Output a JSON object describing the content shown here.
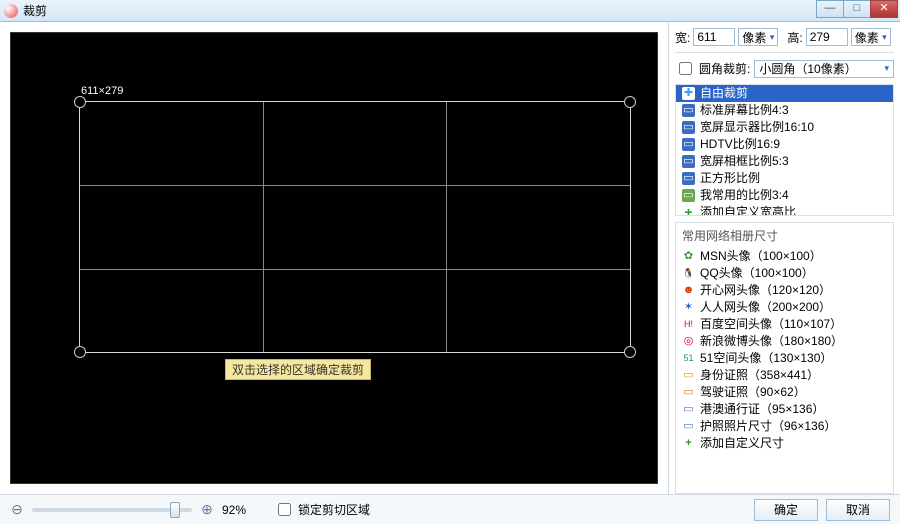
{
  "window": {
    "title": "裁剪"
  },
  "canvas": {
    "dimension_label": "611×279",
    "hint": "双击选择的区域确定裁剪"
  },
  "dims": {
    "width_label": "宽:",
    "width_value": "611",
    "width_unit": "像素",
    "height_label": "高:",
    "height_value": "279",
    "height_unit": "像素"
  },
  "round": {
    "checkbox_label": "圆角裁剪:",
    "select_label": "小圆角（10像素）"
  },
  "ratios": [
    {
      "icon": "✚",
      "icon_bg": "#fff",
      "icon_color": "#4aa0e8",
      "label": "自由裁剪",
      "selected": true
    },
    {
      "icon": "▭",
      "icon_bg": "#3a6cc0",
      "icon_color": "#fff",
      "label": "标准屏幕比例4:3"
    },
    {
      "icon": "▭",
      "icon_bg": "#3a6cc0",
      "icon_color": "#fff",
      "label": "宽屏显示器比例16:10"
    },
    {
      "icon": "▭",
      "icon_bg": "#3a6cc0",
      "icon_color": "#fff",
      "label": "HDTV比例16:9"
    },
    {
      "icon": "▭",
      "icon_bg": "#3a6cc0",
      "icon_color": "#fff",
      "label": "宽屏相框比例5:3"
    },
    {
      "icon": "▭",
      "icon_bg": "#3a6cc0",
      "icon_color": "#fff",
      "label": "正方形比例"
    },
    {
      "icon": "▭",
      "icon_bg": "#6aa84f",
      "icon_color": "#fff",
      "label": "我常用的比例3:4"
    },
    {
      "icon": "+",
      "icon_bg": "transparent",
      "icon_color": "#2a9a2a",
      "label": "添加自定义宽高比"
    }
  ],
  "presets_header": "常用网络相册尺寸",
  "presets": [
    {
      "icon": "✿",
      "icon_color": "#3a9a3a",
      "label": "MSN头像（100×100）"
    },
    {
      "icon": "🐧",
      "icon_color": "#d88b00",
      "label": "QQ头像（100×100）"
    },
    {
      "icon": "☻",
      "icon_color": "#d83a00",
      "label": "开心网头像（120×120）"
    },
    {
      "icon": "✶",
      "icon_color": "#1a5fc8",
      "label": "人人网头像（200×200）"
    },
    {
      "icon": "H!",
      "icon_color": "#d8002a",
      "label": "百度空间头像（110×107）"
    },
    {
      "icon": "◎",
      "icon_color": "#d8002a",
      "label": "新浪微博头像（180×180）"
    },
    {
      "icon": "51",
      "icon_color": "#1a9a6a",
      "label": "51空间头像（130×130）"
    },
    {
      "icon": "▭",
      "icon_color": "#d8a000",
      "label": "身份证照（358×441）"
    },
    {
      "icon": "▭",
      "icon_color": "#d87a00",
      "label": "驾驶证照（90×62）"
    },
    {
      "icon": "▭",
      "icon_color": "#4a7ac8",
      "label": "港澳通行证（95×136）"
    },
    {
      "icon": "▭",
      "icon_color": "#4a7ac8",
      "label": "护照照片尺寸（96×136）"
    },
    {
      "icon": "+",
      "icon_color": "#2a9a2a",
      "label": "添加自定义尺寸"
    }
  ],
  "footer": {
    "zoom_percent": "92%",
    "lock_label": "锁定剪切区域",
    "ok": "确定",
    "cancel": "取消"
  }
}
